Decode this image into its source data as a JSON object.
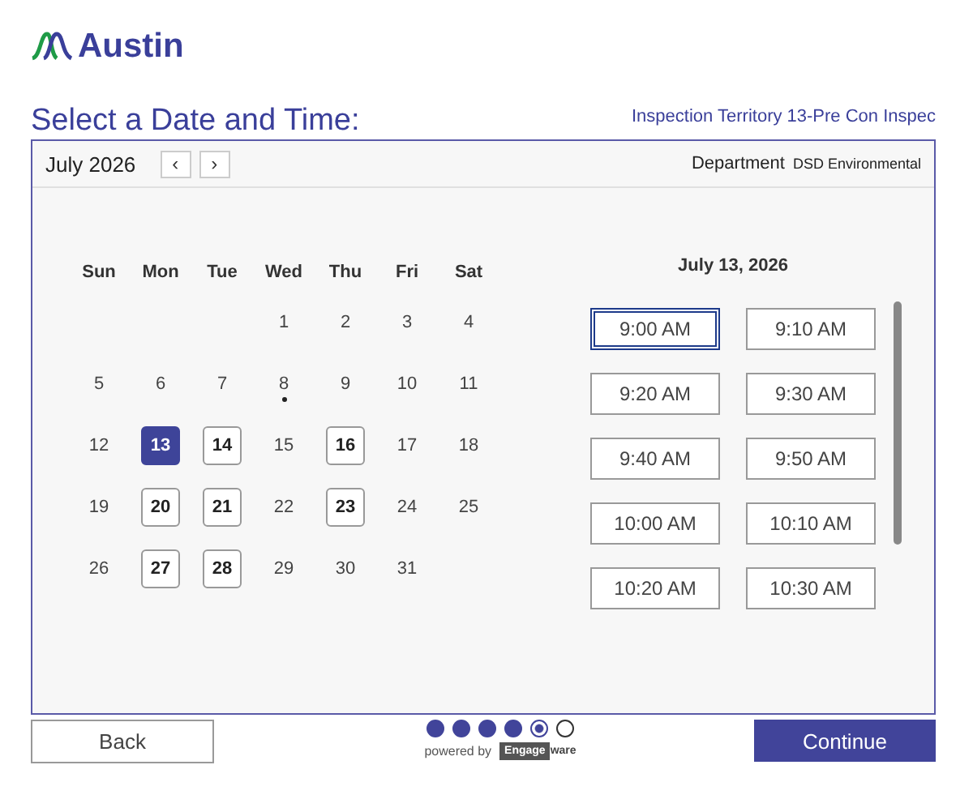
{
  "brand": {
    "name": "Austin"
  },
  "title": "Select a Date and Time:",
  "service": "Inspection Territory 13-Pre Con Inspec",
  "calendar": {
    "month": "July 2026",
    "prev": "‹",
    "next": "›",
    "department_label": "Department",
    "department": "DSD Environmental",
    "weekdays": [
      "Sun",
      "Mon",
      "Tue",
      "Wed",
      "Thu",
      "Fri",
      "Sat"
    ],
    "weeks": [
      [
        {
          "kind": "blank"
        },
        {
          "kind": "blank"
        },
        {
          "kind": "blank"
        },
        {
          "kind": "plain",
          "day": "1"
        },
        {
          "kind": "plain",
          "day": "2"
        },
        {
          "kind": "plain",
          "day": "3"
        },
        {
          "kind": "plain",
          "day": "4"
        }
      ],
      [
        {
          "kind": "plain",
          "day": "5"
        },
        {
          "kind": "plain",
          "day": "6"
        },
        {
          "kind": "plain",
          "day": "7"
        },
        {
          "kind": "marked",
          "day": "8"
        },
        {
          "kind": "plain",
          "day": "9"
        },
        {
          "kind": "plain",
          "day": "10"
        },
        {
          "kind": "plain",
          "day": "11"
        }
      ],
      [
        {
          "kind": "plain",
          "day": "12"
        },
        {
          "kind": "selected",
          "day": "13"
        },
        {
          "kind": "available",
          "day": "14"
        },
        {
          "kind": "plain",
          "day": "15"
        },
        {
          "kind": "available",
          "day": "16"
        },
        {
          "kind": "plain",
          "day": "17"
        },
        {
          "kind": "plain",
          "day": "18"
        }
      ],
      [
        {
          "kind": "plain",
          "day": "19"
        },
        {
          "kind": "available",
          "day": "20"
        },
        {
          "kind": "available",
          "day": "21"
        },
        {
          "kind": "plain",
          "day": "22"
        },
        {
          "kind": "available",
          "day": "23"
        },
        {
          "kind": "plain",
          "day": "24"
        },
        {
          "kind": "plain",
          "day": "25"
        }
      ],
      [
        {
          "kind": "plain",
          "day": "26"
        },
        {
          "kind": "available",
          "day": "27"
        },
        {
          "kind": "available",
          "day": "28"
        },
        {
          "kind": "plain",
          "day": "29"
        },
        {
          "kind": "plain",
          "day": "30"
        },
        {
          "kind": "plain",
          "day": "31"
        },
        {
          "kind": "blank"
        }
      ]
    ]
  },
  "times": {
    "date": "July 13, 2026",
    "slots": [
      {
        "label": "9:00 AM",
        "selected": true
      },
      {
        "label": "9:10 AM",
        "selected": false
      },
      {
        "label": "9:20 AM",
        "selected": false
      },
      {
        "label": "9:30 AM",
        "selected": false
      },
      {
        "label": "9:40 AM",
        "selected": false
      },
      {
        "label": "9:50 AM",
        "selected": false
      },
      {
        "label": "10:00 AM",
        "selected": false
      },
      {
        "label": "10:10 AM",
        "selected": false
      },
      {
        "label": "10:20 AM",
        "selected": false
      },
      {
        "label": "10:30 AM",
        "selected": false
      }
    ]
  },
  "footer": {
    "back": "Back",
    "continue": "Continue",
    "steps": [
      {
        "kind": "done"
      },
      {
        "kind": "done"
      },
      {
        "kind": "done"
      },
      {
        "kind": "done"
      },
      {
        "kind": "current"
      },
      {
        "kind": "todo"
      }
    ],
    "powered_by": "powered by",
    "vendor_box": "Engage",
    "vendor_rest": "ware"
  }
}
